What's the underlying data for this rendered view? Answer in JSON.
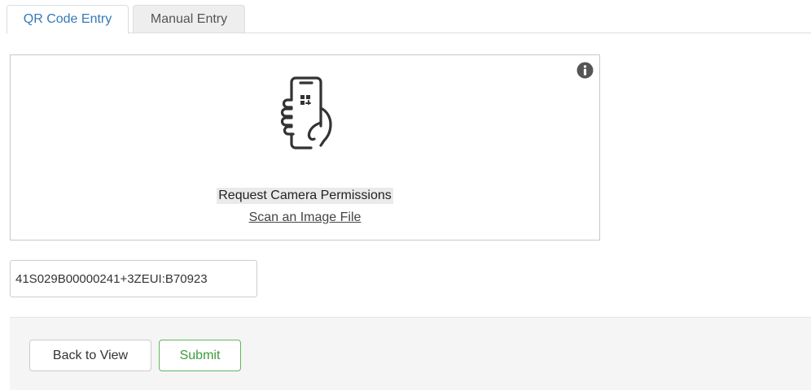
{
  "tabs": [
    {
      "label": "QR Code Entry",
      "active": true
    },
    {
      "label": "Manual Entry",
      "active": false
    }
  ],
  "scanner": {
    "info_icon": "info-circle-icon",
    "illustration_icon": "hand-holding-phone-qr-icon",
    "request_permissions_label": "Request Camera Permissions",
    "scan_file_label": "Scan an Image File"
  },
  "code_input": {
    "value": "41S029B00000241+3ZEUI:B70923"
  },
  "footer": {
    "back_label": "Back to View",
    "submit_label": "Submit"
  },
  "colors": {
    "active_tab_text": "#337ab7",
    "submit_border": "#5cb85c",
    "footer_bg": "#f5f5f5"
  }
}
